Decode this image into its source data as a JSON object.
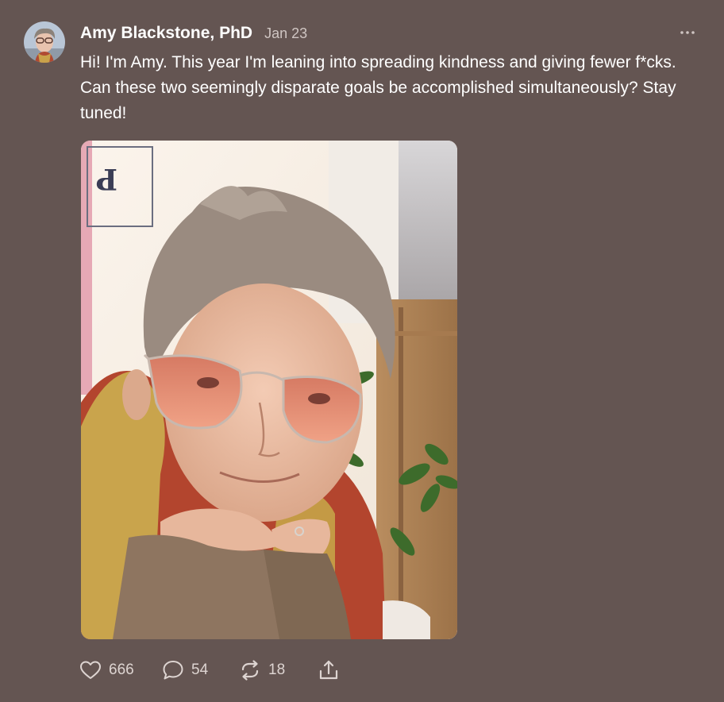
{
  "post": {
    "author": "Amy Blackstone, PhD",
    "date": "Jan 23",
    "text": "Hi! I'm Amy. This year I'm leaning into spreading kindness and giving fewer f*cks. Can these two seemingly disparate goals be accomplished simultaneously? Stay tuned!",
    "avatar_icon": "avatar-photo",
    "photo_description_icon": "selfie-photo",
    "more_icon": "more-horizontal-icon"
  },
  "actions": {
    "like_count": "666",
    "comment_count": "54",
    "restack_count": "18",
    "like_icon": "heart-icon",
    "comment_icon": "comment-bubble-icon",
    "restack_icon": "restack-arrows-icon",
    "share_icon": "share-upload-icon"
  },
  "colors": {
    "background": "#645552",
    "text": "#ffffff",
    "muted_text": "#cfc5c2",
    "action_icons": "#ddd4d1"
  }
}
